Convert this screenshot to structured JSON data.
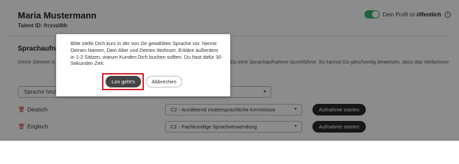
{
  "profile": {
    "name": "Maria Mustermann",
    "talent_id": "Talent ID: frrzvd4th",
    "status_prefix": "Dein Profil ist ",
    "status_value": "öffentlich",
    "info_glyph": "i"
  },
  "section": {
    "title": "Sprachaufna",
    "description_left": "Deine Stimme is                                         (oder Sofphone,                                        Wenn Du mehrere",
    "description_right": "Du eine Sprachaufnahme durchführst. So kannst Du gleichzeitig beweisen, dass das Webphone",
    "add_language_label": "Sprache hinzu",
    "caret": "▾"
  },
  "languages": [
    {
      "name": "Deutsch",
      "level": "C2 - Annähernd muttersprachliche Kenntnisse",
      "button": "Aufnahme starten"
    },
    {
      "name": "Englisch",
      "level": "C1 - Fachkundige Sprachverwendung",
      "button": "Aufnahme starten"
    }
  ],
  "modal": {
    "text": "Bitte stelle Dich kurz in der von Dir gewählten Sprache vor. Nenne Deinen Namen, Dein Alter und Deinen Wohnort. Erkläre außerdem in 1-2 Sätzen, warum Kunden Dich buchen sollten. Du hast dafür 30 Sekunden Zeit.",
    "primary_button": "Los geht's",
    "secondary_button": "Abbrechen"
  },
  "colors": {
    "toggle": "#3cb371",
    "highlight": "#d71920",
    "dark_button": "#2b2b2b"
  },
  "icons": {
    "trash": "trash-icon",
    "info": "info-icon",
    "caret": "chevron-down-icon"
  }
}
